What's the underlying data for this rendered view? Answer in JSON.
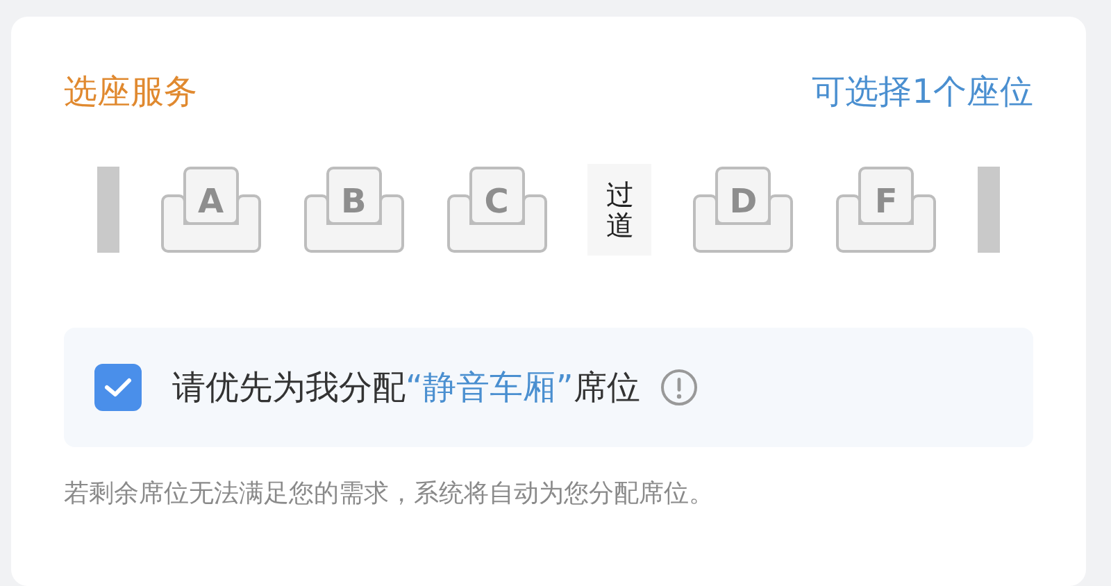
{
  "title": "选座服务",
  "hint": "可选择1个座位",
  "seat_row": [
    {
      "kind": "wall"
    },
    {
      "kind": "seat",
      "label": "A"
    },
    {
      "kind": "seat",
      "label": "B"
    },
    {
      "kind": "seat",
      "label": "C"
    },
    {
      "kind": "aisle",
      "label": "过道"
    },
    {
      "kind": "seat",
      "label": "D"
    },
    {
      "kind": "seat",
      "label": "F"
    },
    {
      "kind": "wall"
    }
  ],
  "preference": {
    "checked": true,
    "text_before": "请优先为我分配",
    "highlight": "“静音车厢”",
    "text_after": "席位"
  },
  "note": "若剩余席位无法满足您的需求，系统将自动为您分配席位。"
}
